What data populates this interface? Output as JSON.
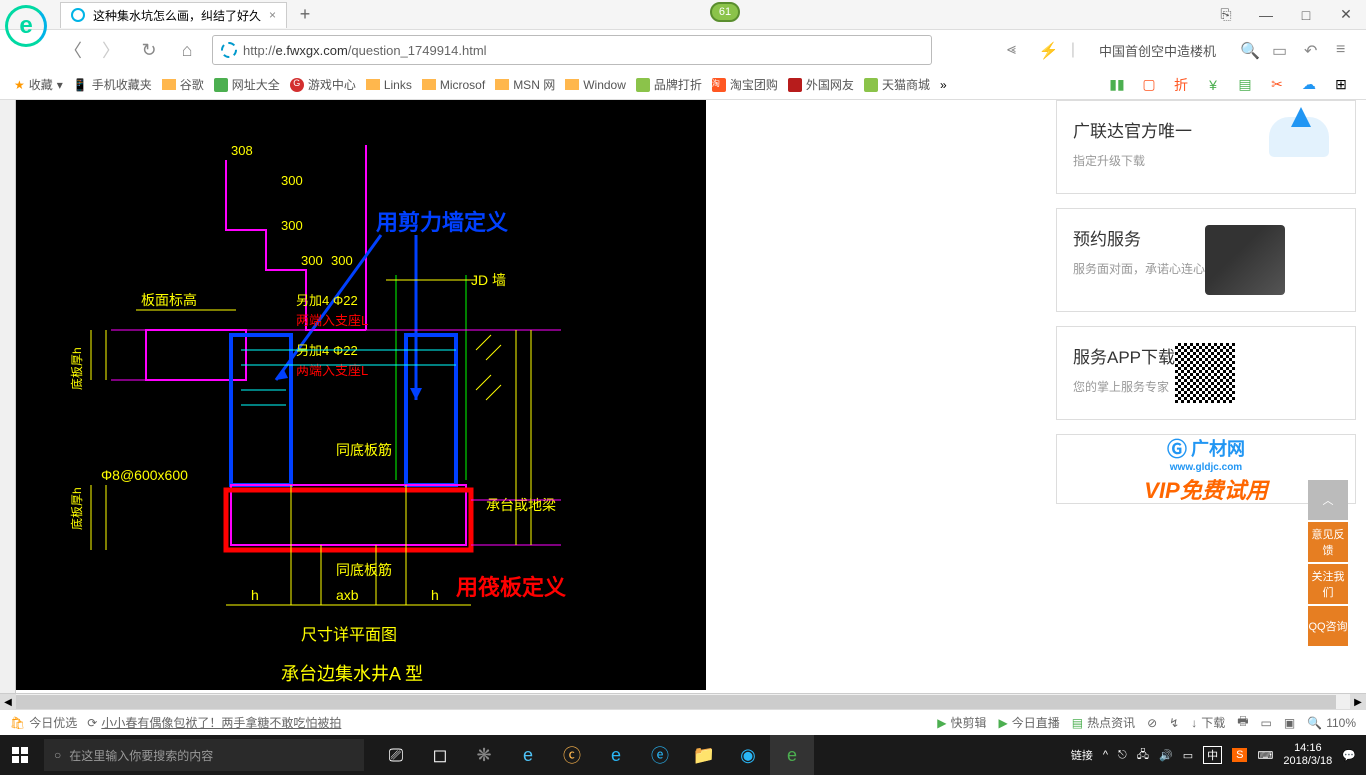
{
  "titlebar": {
    "tab_title": "这种集水坑怎么画，纠结了好久",
    "badge": "61"
  },
  "nav": {
    "url_prefix": "http://",
    "url_domain": "e.fwxgx.com",
    "url_path": "/question_1749914.html",
    "search_hint": "中国首创空中造楼机"
  },
  "bookmarks": {
    "fav": "收藏",
    "mobile": "手机收藏夹",
    "google": "谷歌",
    "sites": "网址大全",
    "game": "游戏中心",
    "links": "Links",
    "microsof": "Microsof",
    "msn": "MSN 网",
    "window": "Window",
    "brand": "品牌打折",
    "taobao": "淘宝团购",
    "foreign": "外国网友",
    "tmall": "天猫商城"
  },
  "cad": {
    "annotation_blue": "用剪力墙定义",
    "annotation_red": "用筏板定义",
    "dim_308": "308",
    "dim_300": "300",
    "label_bmbg": "板面标高",
    "label_jd": "JD 墙",
    "label_add22_1": "另加4 Φ22",
    "label_ends_1": "两端入支座L",
    "label_add22_2": "另加4 Φ22",
    "label_ends_2": "两端入支座L",
    "label_bottom_rebar": "同底板筋",
    "label_bottom_rebar2": "同底板筋",
    "label_spec": "Φ8@600x600",
    "label_ctd": "承台或地梁",
    "label_h": "h",
    "label_axb": "axb",
    "label_dims": "尺寸详平面图",
    "label_title": "承台边集水井A 型",
    "label_dbh": "底板厚h",
    "label_dbh2": "底板厚h"
  },
  "cards": {
    "c1_title": "广联达官方唯一",
    "c1_sub": "指定升级下载",
    "c2_title": "预约服务",
    "c2_sub": "服务面对面，承诺心连心",
    "c3_title": "服务APP下载",
    "c3_sub": "您的掌上服务专家",
    "vip_brand": "广材网",
    "vip_url": "www.gldjc.com",
    "vip_text": "VIP免费试用"
  },
  "float": {
    "feedback": "意见反馈",
    "follow": "关注我们",
    "qq": "QQ咨询"
  },
  "status": {
    "today": "今日优选",
    "news": "小小春有偶像包袱了！两手拿糖不敢吃怕被拍",
    "clip": "快剪辑",
    "live": "今日直播",
    "hot": "热点资讯",
    "down": "下载",
    "zoom": "110%"
  },
  "taskbar": {
    "search": "在这里输入你要搜索的内容",
    "link": "链接",
    "ime": "中",
    "time": "14:16",
    "date": "2018/3/18"
  }
}
